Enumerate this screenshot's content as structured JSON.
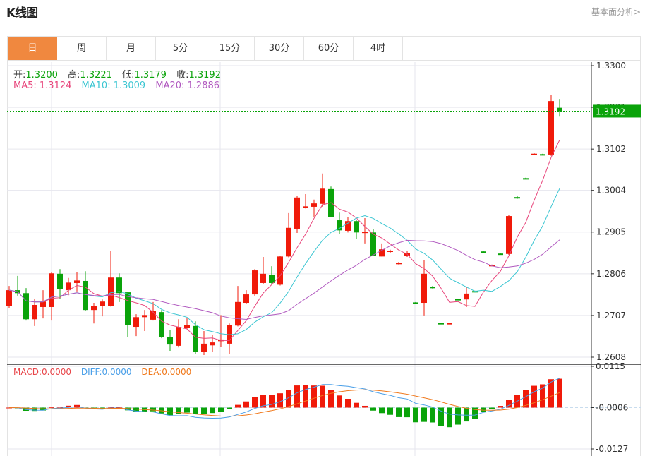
{
  "header": {
    "title": "K线图",
    "more_link": "基本面分析>"
  },
  "tabs": [
    {
      "label": "日",
      "active": true
    },
    {
      "label": "周"
    },
    {
      "label": "月"
    },
    {
      "label": "5分"
    },
    {
      "label": "15分"
    },
    {
      "label": "30分"
    },
    {
      "label": "60分"
    },
    {
      "label": "4时"
    }
  ],
  "ohlc_info": {
    "open_label": "开:",
    "open": "1.3200",
    "high_label": "高:",
    "high": "1.3221",
    "low_label": "低:",
    "low": "1.3179",
    "close_label": "收:",
    "close": "1.3192"
  },
  "ma_info": {
    "ma5_label": "MA5:",
    "ma5": "1.3124",
    "ma10_label": "MA10:",
    "ma10": "1.3009",
    "ma20_label": "MA20:",
    "ma20": "1.2886"
  },
  "macd_info": {
    "macd_label": "MACD:",
    "macd": "0.0000",
    "diff_label": "DIFF:",
    "diff": "0.0000",
    "dea_label": "DEA:",
    "dea": "0.0000"
  },
  "colors": {
    "up": "#f01a0a",
    "down": "#0aa30a",
    "active_tab": "#f0883f",
    "ma5": "#e8467c",
    "ma10": "#3cc6d2",
    "ma20": "#b15ac0",
    "diff": "#4a9fe8",
    "dea": "#f07a1e",
    "text_up_value": "#0aa30a"
  },
  "chart_data": {
    "type": "candlestick",
    "price_axis_ticks": [
      "1.3300",
      "1.3201",
      "1.3102",
      "1.3004",
      "1.2905",
      "1.2806",
      "1.2707",
      "1.2608"
    ],
    "price_range": [
      1.2608,
      1.33
    ],
    "current_price": "1.3192",
    "macd_axis_ticks": [
      "0.0115",
      "-0.0006",
      "-0.0127"
    ],
    "macd_range": [
      -0.0127,
      0.0115
    ],
    "candles": [
      [
        1.273,
        1.2777,
        1.2725,
        1.2767
      ],
      [
        1.2767,
        1.2801,
        1.2754,
        1.276
      ],
      [
        1.276,
        1.2772,
        1.2695,
        1.2698
      ],
      [
        1.2698,
        1.2747,
        1.2682,
        1.2732
      ],
      [
        1.2727,
        1.2767,
        1.27,
        1.274
      ],
      [
        1.2727,
        1.2809,
        1.2695,
        1.2807
      ],
      [
        1.2806,
        1.2817,
        1.2747,
        1.2769
      ],
      [
        1.2767,
        1.2796,
        1.2755,
        1.2785
      ],
      [
        1.2784,
        1.2809,
        1.2764,
        1.279
      ],
      [
        1.2789,
        1.2812,
        1.2718,
        1.272
      ],
      [
        1.272,
        1.2737,
        1.2688,
        1.273
      ],
      [
        1.2729,
        1.2745,
        1.2705,
        1.274
      ],
      [
        1.273,
        1.2861,
        1.2728,
        1.2797
      ],
      [
        1.2797,
        1.2807,
        1.2739,
        1.276
      ],
      [
        1.2762,
        1.2762,
        1.2656,
        1.2685
      ],
      [
        1.268,
        1.271,
        1.2658,
        1.2703
      ],
      [
        1.2703,
        1.272,
        1.267,
        1.2708
      ],
      [
        1.2697,
        1.2739,
        1.2695,
        1.2717
      ],
      [
        1.2715,
        1.272,
        1.2653,
        1.2655
      ],
      [
        1.2656,
        1.2673,
        1.2623,
        1.2638
      ],
      [
        1.2635,
        1.2698,
        1.2631,
        1.268
      ],
      [
        1.2678,
        1.2702,
        1.2675,
        1.2685
      ],
      [
        1.2682,
        1.2693,
        1.2616,
        1.262
      ],
      [
        1.262,
        1.267,
        1.2613,
        1.264
      ],
      [
        1.2636,
        1.266,
        1.262,
        1.2643
      ],
      [
        1.2646,
        1.2708,
        1.2633,
        1.265
      ],
      [
        1.264,
        1.2688,
        1.2615,
        1.2685
      ],
      [
        1.2683,
        1.2777,
        1.2681,
        1.2739
      ],
      [
        1.2737,
        1.2767,
        1.2735,
        1.2757
      ],
      [
        1.2757,
        1.2817,
        1.2754,
        1.2814
      ],
      [
        1.2784,
        1.2846,
        1.2782,
        1.2806
      ],
      [
        1.2804,
        1.2824,
        1.2779,
        1.2784
      ],
      [
        1.278,
        1.2849,
        1.2778,
        1.2847
      ],
      [
        1.2847,
        1.295,
        1.2845,
        1.2915
      ],
      [
        1.2913,
        1.299,
        1.2903,
        1.2987
      ],
      [
        1.2963,
        1.2995,
        1.2961,
        1.2966
      ],
      [
        1.2965,
        1.2982,
        1.294,
        1.2973
      ],
      [
        1.2972,
        1.3044,
        1.2965,
        1.3008
      ],
      [
        1.3007,
        1.3013,
        1.294,
        1.2941
      ],
      [
        1.2933,
        1.2951,
        1.2901,
        1.2909
      ],
      [
        1.2908,
        1.2941,
        1.2904,
        1.2931
      ],
      [
        1.2931,
        1.2933,
        1.2888,
        1.2904
      ],
      [
        1.2904,
        1.2938,
        1.2878,
        1.2906
      ],
      [
        1.2904,
        1.2913,
        1.2849,
        1.2849
      ],
      [
        1.2847,
        1.2878,
        1.2847,
        1.2864
      ],
      [
        1.2858,
        1.2863,
        1.2856,
        1.2861
      ],
      [
        1.2829,
        1.2834,
        1.2828,
        1.2832
      ],
      [
        1.2849,
        1.2861,
        1.2846,
        1.2856
      ],
      [
        1.2738,
        1.2739,
        1.2735,
        1.2736
      ],
      [
        1.2737,
        1.2839,
        1.2707,
        1.2806
      ],
      [
        1.2775,
        1.2777,
        1.2771,
        1.2773
      ],
      [
        1.2689,
        1.269,
        1.2686,
        1.2687
      ],
      [
        1.2687,
        1.269,
        1.2686,
        1.2689
      ],
      [
        1.2746,
        1.2747,
        1.2743,
        1.2744
      ],
      [
        1.2745,
        1.2774,
        1.2727,
        1.2759
      ],
      [
        1.2765,
        1.2766,
        1.2762,
        1.2763
      ],
      [
        1.2859,
        1.2861,
        1.2855,
        1.2857
      ],
      [
        1.2825,
        1.2828,
        1.2824,
        1.2827
      ],
      [
        1.2854,
        1.2855,
        1.2851,
        1.2852
      ],
      [
        1.2853,
        1.2945,
        1.2851,
        1.2943
      ],
      [
        1.2988,
        1.299,
        1.2984,
        1.2986
      ],
      [
        1.3033,
        1.3034,
        1.303,
        1.3031
      ],
      [
        1.3088,
        1.3092,
        1.3088,
        1.3091
      ],
      [
        1.309,
        1.3091,
        1.3087,
        1.3088
      ],
      [
        1.3089,
        1.323,
        1.3086,
        1.3216
      ],
      [
        1.32,
        1.3221,
        1.3179,
        1.3192
      ]
    ],
    "candle_format": [
      "open",
      "high",
      "low",
      "close"
    ],
    "moving_averages": [
      "MA5",
      "MA10",
      "MA20"
    ],
    "grid": true
  }
}
